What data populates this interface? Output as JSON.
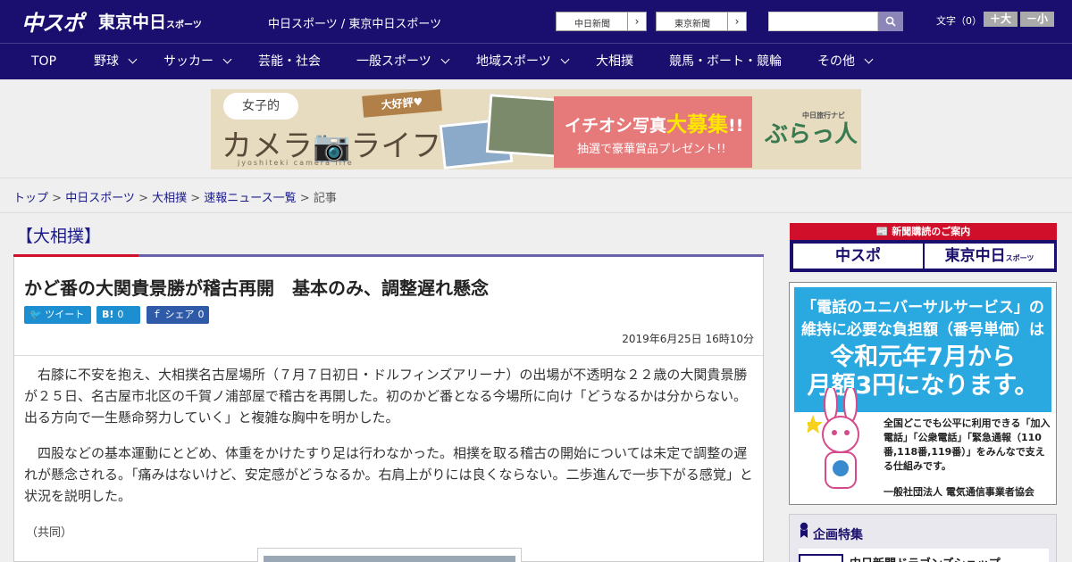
{
  "header": {
    "logo_chuspo": "中スポ",
    "logo_tokyo": "東京中日",
    "logo_tokyo_small": "スポーツ",
    "tagline": "中日スポーツ / 東京中日スポーツ",
    "link_chunichi": "中日新聞",
    "link_tokyo": "東京新聞",
    "search_placeholder": "",
    "fontsize_label": "文字（0）",
    "font_larger": "＋大",
    "font_smaller": "－小"
  },
  "nav": {
    "items": [
      {
        "label": "TOP"
      },
      {
        "label": "野球"
      },
      {
        "label": "サッカー"
      },
      {
        "label": "芸能・社会"
      },
      {
        "label": "一般スポーツ"
      },
      {
        "label": "地域スポーツ"
      },
      {
        "label": "大相撲"
      },
      {
        "label": "競馬・ボート・競輪"
      },
      {
        "label": "その他"
      }
    ]
  },
  "banner": {
    "bubble": "女子的",
    "title": "カメラ📷ライフ",
    "sub": "jyoshiteki camera life",
    "ribbon": "大好評♥",
    "headline_a": "イチオシ写真",
    "headline_b": "大募集",
    "headline_c": "!!",
    "subline": "抽選で豪華賞品プレゼント!!",
    "brand": "ぶらっ人",
    "brand_small": "中日旅行ナビ"
  },
  "breadcrumb": {
    "top": "トップ",
    "chunichi": "中日スポーツ",
    "sumo": "大相撲",
    "news": "速報ニュース一覧",
    "current": "記事",
    "sep": " > "
  },
  "article": {
    "category": "【大相撲】",
    "headline": "かど番の大関貴景勝が稽古再開　基本のみ、調整遅れ懸念",
    "share_tweet": "ツイート",
    "share_hatena": "B!",
    "share_hatena_count": "0",
    "share_fb": "シェア",
    "share_fb_count": "0",
    "date": "2019年6月25日 16時10分",
    "para1": "右膝に不安を抱え、大相撲名古屋場所（７月７日初日・ドルフィンズアリーナ）の出場が不透明な２２歳の大関貴景勝が２５日、名古屋市北区の千賀ノ浦部屋で稽古を再開した。初のかど番となる今場所に向け「どうなるかは分からない。出る方向で一生懸命努力していく」と複雑な胸中を明かした。",
    "para2": "四股などの基本運動にとどめ、体重をかけたすり足は行わなかった。相撲を取る稽古の開始については未定で調整の遅れが懸念される。「痛みはないけど、安定感がどうなるか。右肩上がりには良くならない。二歩進んで一歩下がる感覚」と状況を説明した。",
    "credit": "（共同）"
  },
  "sidebar": {
    "subscribe_head": "新聞購読のご案内",
    "sub_logo1": "中スポ",
    "sub_logo2": "東京中日",
    "sub_logo2_small": "スポーツ",
    "ad_l1a": "「電話のユニバーサルサービス」の",
    "ad_l1b": "維持に必要な負担額（番号単価）は",
    "ad_l2": "令和元年7月から",
    "ad_l3": "月額3円になります。",
    "ad_desc": "全国どこでも公平に利用できる「加入電話」「公衆電話」「緊急通報（110番,118番,119番）」をみんなで支える仕組みです。",
    "ad_org": "一般社団法人 電気通信事業者協会",
    "feature_title": "企画特集",
    "feature_item": "中日新聞ドラゴンズショップ"
  },
  "colors": {
    "header_bg": "#1a0f6e",
    "accent_red": "#d0102a",
    "link": "#1a1a8a"
  }
}
